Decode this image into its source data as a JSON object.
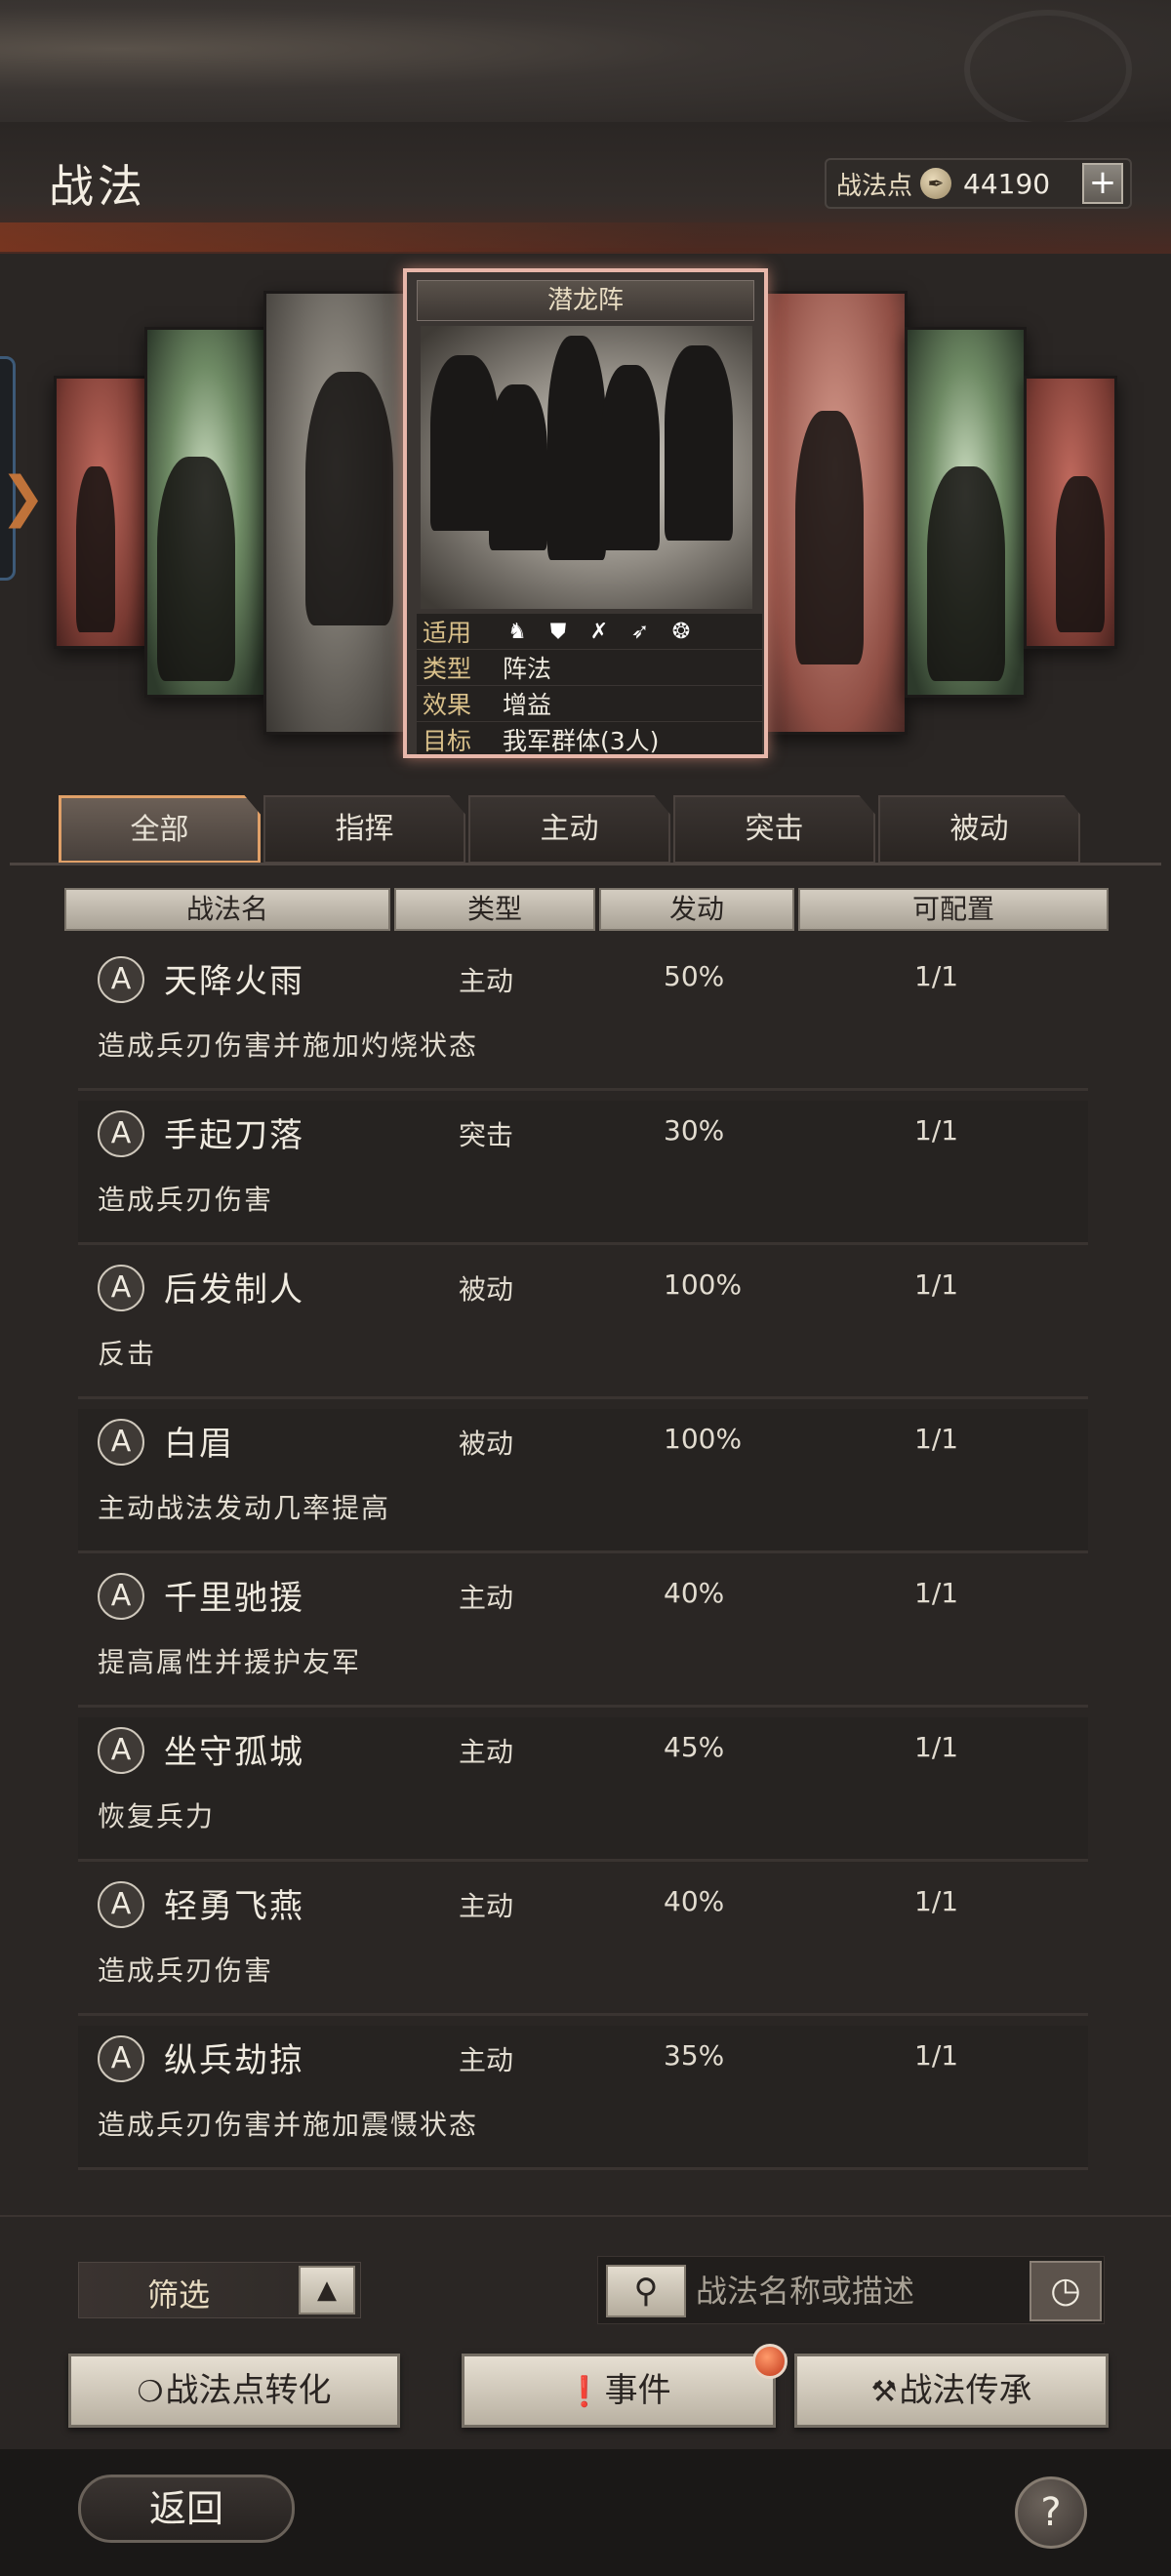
{
  "header": {
    "title": "战法",
    "points_label": "战法点",
    "points_value": "44190",
    "plus_label": "+"
  },
  "featured_card": {
    "name": "潜龙阵",
    "info": [
      {
        "key": "适用",
        "icons": [
          "cavalry-icon",
          "shield-icon",
          "bow-icon",
          "spear-icon",
          "wheel-icon"
        ]
      },
      {
        "key": "类型",
        "value": "阵法"
      },
      {
        "key": "效果",
        "value": "增益"
      },
      {
        "key": "目标",
        "value": "我军群体(3人)"
      }
    ]
  },
  "tabs": [
    {
      "label": "全部",
      "active": true
    },
    {
      "label": "指挥",
      "active": false
    },
    {
      "label": "主动",
      "active": false
    },
    {
      "label": "突击",
      "active": false
    },
    {
      "label": "被动",
      "active": false
    }
  ],
  "columns": [
    "战法名",
    "类型",
    "发动",
    "可配置"
  ],
  "skills": [
    {
      "grade": "A",
      "name": "天降火雨",
      "type": "主动",
      "rate": "50%",
      "config": "1/1",
      "desc": "造成兵刃伤害并施加灼烧状态"
    },
    {
      "grade": "A",
      "name": "手起刀落",
      "type": "突击",
      "rate": "30%",
      "config": "1/1",
      "desc": "造成兵刃伤害"
    },
    {
      "grade": "A",
      "name": "后发制人",
      "type": "被动",
      "rate": "100%",
      "config": "1/1",
      "desc": "反击"
    },
    {
      "grade": "A",
      "name": "白眉",
      "type": "被动",
      "rate": "100%",
      "config": "1/1",
      "desc": "主动战法发动几率提高"
    },
    {
      "grade": "A",
      "name": "千里驰援",
      "type": "主动",
      "rate": "40%",
      "config": "1/1",
      "desc": "提高属性并援护友军"
    },
    {
      "grade": "A",
      "name": "坐守孤城",
      "type": "主动",
      "rate": "45%",
      "config": "1/1",
      "desc": "恢复兵力"
    },
    {
      "grade": "A",
      "name": "轻勇飞燕",
      "type": "主动",
      "rate": "40%",
      "config": "1/1",
      "desc": "造成兵刃伤害"
    },
    {
      "grade": "A",
      "name": "纵兵劫掠",
      "type": "主动",
      "rate": "35%",
      "config": "1/1",
      "desc": "造成兵刃伤害并施加震慑状态"
    }
  ],
  "filter": {
    "label": "筛选",
    "toggle": "▲"
  },
  "search": {
    "placeholder": "战法名称或描述"
  },
  "actions": {
    "convert": "战法点转化",
    "events": "事件",
    "inherit": "战法传承"
  },
  "footer": {
    "back": "返回",
    "help": "?"
  }
}
